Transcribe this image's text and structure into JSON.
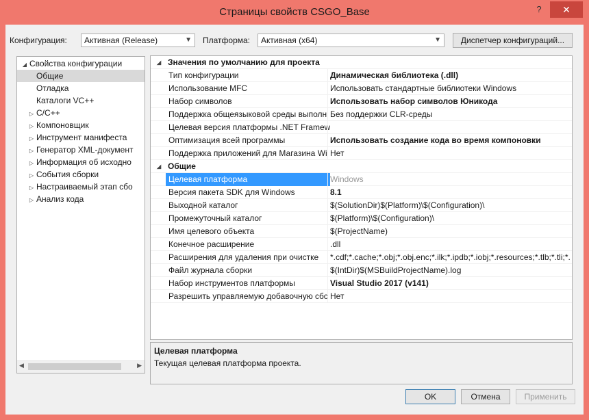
{
  "window": {
    "title": "Страницы свойств CSGO_Base",
    "help_glyph": "?",
    "close_glyph": "✕"
  },
  "toolbar": {
    "config_label": "Конфигурация:",
    "config_value": "Активная (Release)",
    "platform_label": "Платформа:",
    "platform_value": "Активная (x64)",
    "manager_button": "Диспетчер конфигураций..."
  },
  "tree": {
    "root": "Свойства конфигурации",
    "items": [
      {
        "label": "Общие",
        "expandable": false,
        "selected": true
      },
      {
        "label": "Отладка",
        "expandable": false
      },
      {
        "label": "Каталоги VC++",
        "expandable": false
      },
      {
        "label": "C/C++",
        "expandable": true
      },
      {
        "label": "Компоновщик",
        "expandable": true
      },
      {
        "label": "Инструмент манифеста",
        "expandable": true
      },
      {
        "label": "Генератор XML-документ",
        "expandable": true
      },
      {
        "label": "Информация об исходно",
        "expandable": true
      },
      {
        "label": "События сборки",
        "expandable": true
      },
      {
        "label": "Настраиваемый этап сбо",
        "expandable": true
      },
      {
        "label": "Анализ кода",
        "expandable": true
      }
    ]
  },
  "grid": {
    "categories": [
      {
        "label": "Значения по умолчанию для проекта",
        "rows": [
          {
            "name": "Тип конфигурации",
            "value": "Динамическая библиотека (.dll)",
            "bold": true
          },
          {
            "name": "Использование MFC",
            "value": "Использовать стандартные библиотеки Windows",
            "bold": false
          },
          {
            "name": "Набор символов",
            "value": "Использовать набор символов Юникода",
            "bold": true
          },
          {
            "name": "Поддержка общеязыковой среды выполн",
            "value": "Без поддержки CLR-среды",
            "bold": false
          },
          {
            "name": "Целевая версия платформы .NET Framew",
            "value": "",
            "bold": false
          },
          {
            "name": "Оптимизация всей программы",
            "value": "Использовать создание кода во время компоновки",
            "bold": true
          },
          {
            "name": "Поддержка приложений для Магазина Wi",
            "value": "Нет",
            "bold": false
          }
        ]
      },
      {
        "label": "Общие",
        "rows": [
          {
            "name": "Целевая платформа",
            "value": "Windows",
            "bold": false,
            "selected": true
          },
          {
            "name": "Версия пакета SDK для Windows",
            "value": "8.1",
            "bold": true
          },
          {
            "name": "Выходной каталог",
            "value": "$(SolutionDir)$(Platform)\\$(Configuration)\\",
            "bold": false
          },
          {
            "name": "Промежуточный каталог",
            "value": "$(Platform)\\$(Configuration)\\",
            "bold": false
          },
          {
            "name": "Имя целевого объекта",
            "value": "$(ProjectName)",
            "bold": false
          },
          {
            "name": "Конечное расширение",
            "value": ".dll",
            "bold": false
          },
          {
            "name": "Расширения для удаления при очистке",
            "value": "*.cdf;*.cache;*.obj;*.obj.enc;*.ilk;*.ipdb;*.iobj;*.resources;*.tlb;*.tli;*.t",
            "bold": false
          },
          {
            "name": "Файл журнала сборки",
            "value": "$(IntDir)$(MSBuildProjectName).log",
            "bold": false
          },
          {
            "name": "Набор инструментов платформы",
            "value": "Visual Studio 2017 (v141)",
            "bold": true
          },
          {
            "name": "Разрешить управляемую добавочную сбс",
            "value": "Нет",
            "bold": false
          }
        ]
      }
    ]
  },
  "description": {
    "title": "Целевая платформа",
    "text": "Текущая целевая платформа проекта."
  },
  "buttons": {
    "ok": "OK",
    "cancel": "Отмена",
    "apply": "Применить"
  }
}
